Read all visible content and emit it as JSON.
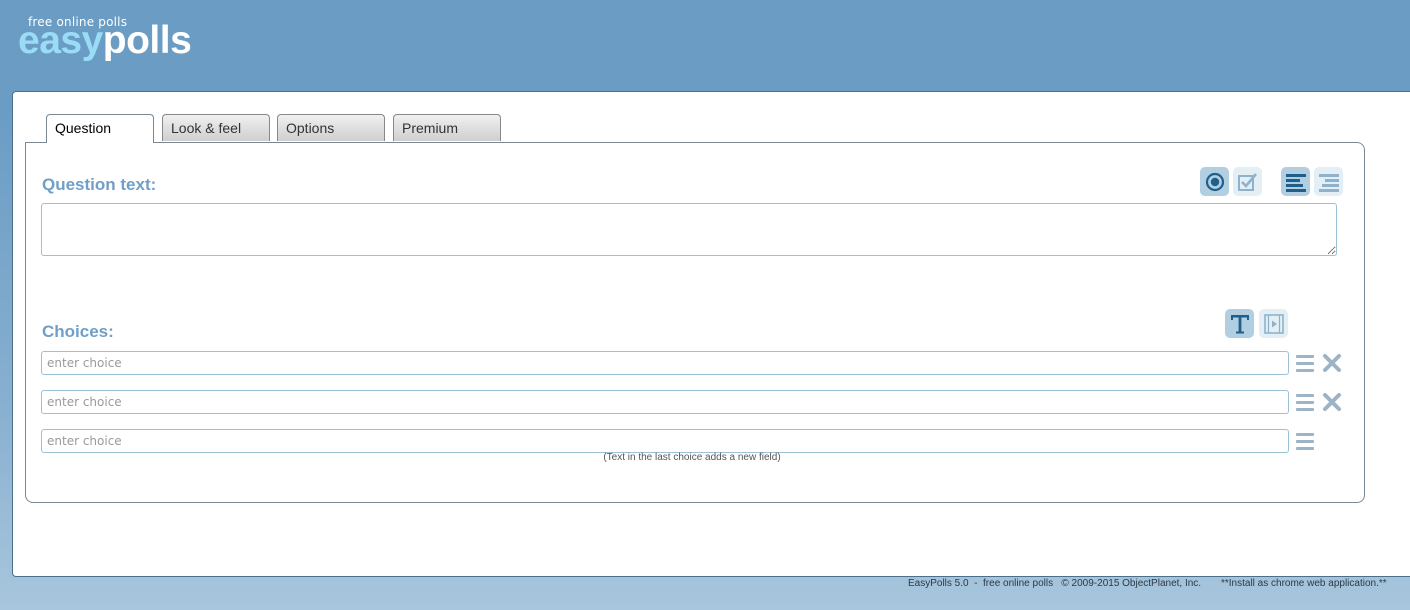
{
  "logo": {
    "tagline": "free online polls",
    "word_easy": "easy",
    "word_polls": "polls"
  },
  "tabs": [
    {
      "label": "Question",
      "active": true
    },
    {
      "label": "Look & feel",
      "active": false
    },
    {
      "label": "Options",
      "active": false
    },
    {
      "label": "Premium",
      "active": false
    }
  ],
  "question": {
    "label": "Question text:",
    "value": "",
    "toolbar": [
      {
        "icon": "radio-single-choice-icon",
        "selected": true
      },
      {
        "icon": "checkbox-multiple-choice-icon",
        "selected": false
      },
      {
        "icon": "align-left-icon",
        "selected": true
      },
      {
        "icon": "align-right-icon",
        "selected": false
      }
    ]
  },
  "choices": {
    "label": "Choices:",
    "toolbar": [
      {
        "icon": "text-type-icon",
        "selected": true
      },
      {
        "icon": "media-type-icon",
        "selected": false
      }
    ],
    "items": [
      {
        "value": "",
        "placeholder": "enter choice",
        "removable": true
      },
      {
        "value": "",
        "placeholder": "enter choice",
        "removable": true
      },
      {
        "value": "",
        "placeholder": "enter choice",
        "removable": false
      }
    ],
    "hint": "(Text in the last choice adds a new field)"
  },
  "footer": {
    "credits": "EasyPolls 5.0  -  free online polls   © 2009-2015 ObjectPlanet, Inc.",
    "install": "**Install as chrome web application.**"
  },
  "colors": {
    "header_bg": "#6a9cc4",
    "label_blue": "#6f9fc8",
    "icon_dark": "#1f5f8b",
    "icon_light": "#8fb2cc"
  }
}
